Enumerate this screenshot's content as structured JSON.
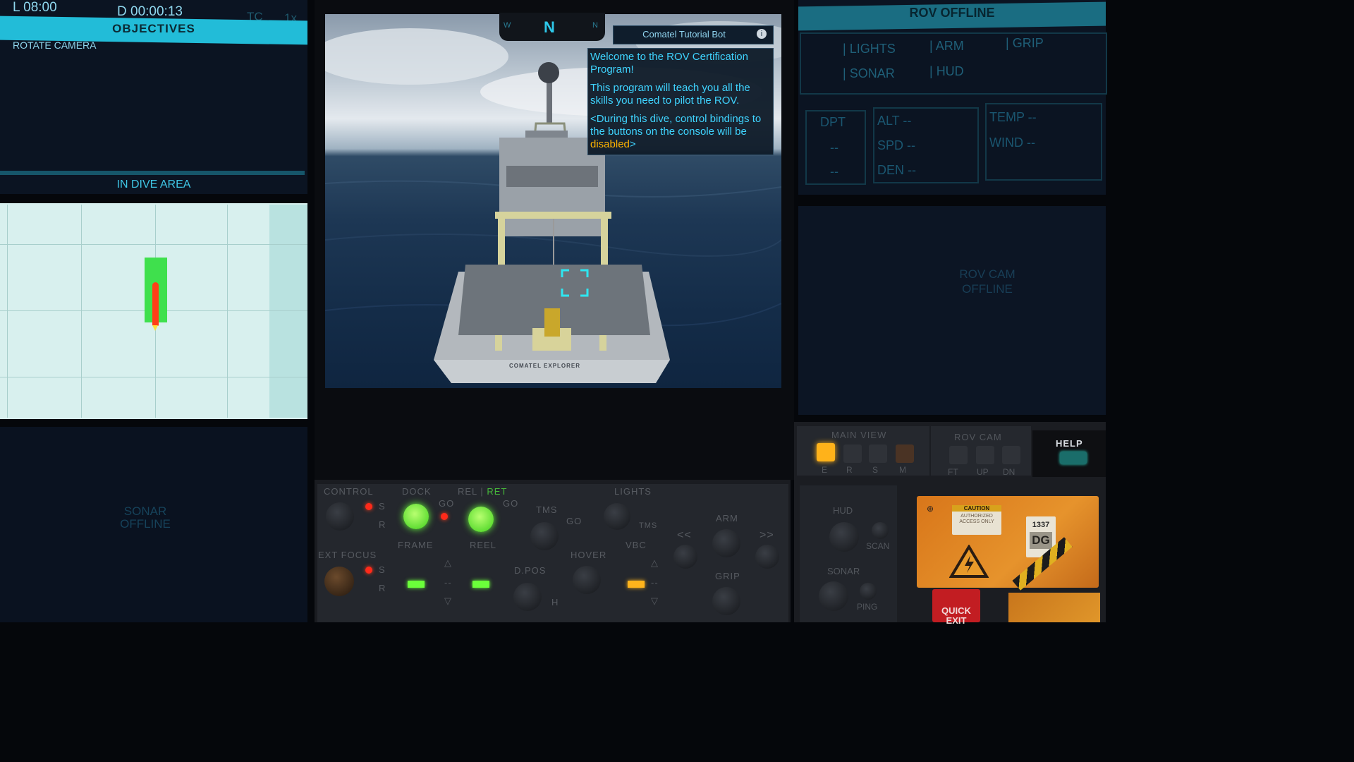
{
  "status": {
    "local_time": "L 08:00",
    "dive_time": "D 00:00:13",
    "tc": "TC",
    "speed": "1x"
  },
  "objectives": {
    "title": "OBJECTIVES",
    "items": [
      "ROTATE CAMERA"
    ]
  },
  "dive_area": {
    "title": "IN DIVE AREA"
  },
  "sonar_panel": {
    "line1": "SONAR",
    "line2": "OFFLINE"
  },
  "compass": {
    "heading": "N",
    "left": "W",
    "right": "N"
  },
  "tutorial_bot": {
    "title": "Comatel Tutorial Bot",
    "info_icon": "i",
    "paragraph1": "Welcome to the ROV Certification Program!",
    "paragraph2": "This program will teach you all the skills you need to pilot the ROV.",
    "paragraph3_prefix": "<During this dive, control bindings to the buttons on the console will be ",
    "paragraph3_keyword": "disabled",
    "paragraph3_suffix": ">"
  },
  "ship_name": "COMATEL EXPLORER",
  "rov_status": {
    "title": "ROV OFFLINE",
    "menu": [
      "LIGHTS",
      "ARM",
      "GRIP",
      "SONAR",
      "HUD"
    ]
  },
  "telemetry": {
    "dpt_label": "DPT",
    "dpt_val1": "--",
    "dpt_val2": "--",
    "alt": "ALT --",
    "spd": "SPD --",
    "den": "DEN --",
    "temp": "TEMP --",
    "wind": "WIND --"
  },
  "rov_cam_panel": {
    "line1": "ROV CAM",
    "line2": "OFFLINE"
  },
  "console": {
    "control": "CONTROL",
    "dock": "DOCK",
    "rel": "REL",
    "ret": "RET",
    "go": "GO",
    "tms": "TMS",
    "lights": "LIGHTS",
    "s": "S",
    "r": "R",
    "ext_focus": "EXT FOCUS",
    "frame": "FRAME",
    "reel": "REEL",
    "hover": "HOVER",
    "vbc": "VBC",
    "dpos": "D.POS",
    "h": "H",
    "arm": "ARM",
    "grip": "GRIP",
    "prev": "<<",
    "next": ">>",
    "up_arrow": "△",
    "down_arrow": "▽",
    "dash": "--"
  },
  "right_console": {
    "main_view": "MAIN VIEW",
    "mv_keys": [
      "E",
      "R",
      "S",
      "M"
    ],
    "rov_cam": "ROV CAM",
    "cam_keys": [
      "FT",
      "UP",
      "DN"
    ],
    "help": "HELP",
    "hud": "HUD",
    "scan": "SCAN",
    "sonar": "SONAR",
    "ping": "PING",
    "caution_title": "CAUTION",
    "caution_text": "AUTHORIZED ACCESS ONLY",
    "tag_number": "1337",
    "tag_letters": "DG",
    "quick_exit": "QUICK EXIT"
  },
  "colors": {
    "accent_cyan": "#22bcd8",
    "bot_text": "#3fd4ff",
    "keyword_amber": "#ffb400",
    "led_green": "#6bff3a",
    "led_red": "#ff2a1a",
    "led_amber": "#ffb21a"
  }
}
